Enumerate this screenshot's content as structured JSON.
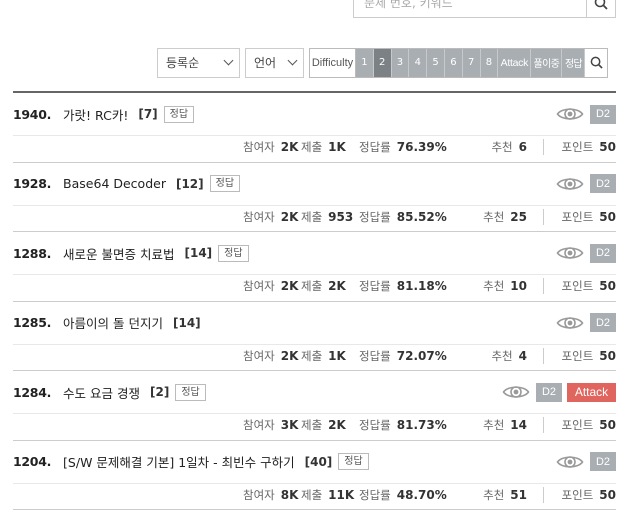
{
  "search": {
    "placeholder": "문제 번호, 키워드"
  },
  "filters": {
    "order_label": "등록순",
    "lang_label": "언어",
    "difficulty_label": "Difficulty",
    "difficulty_levels": [
      "1",
      "2",
      "3",
      "4",
      "5",
      "6",
      "7",
      "8"
    ],
    "active_level": "2",
    "extra_labels": [
      "Attack",
      "풀이중",
      "정답"
    ]
  },
  "labels": {
    "answer_tag": "정답",
    "participants": "참여자",
    "submissions": "제출",
    "accuracy": "정답률",
    "recommend": "추천",
    "points": "포인트"
  },
  "problems": [
    {
      "number": "1940.",
      "title": "가랏! RC카!",
      "count": "[7]",
      "has_answer": true,
      "difficulty": "D2",
      "attack": false,
      "participants": "2K",
      "submissions": "1K",
      "accuracy": "76.39%",
      "recommend": "6",
      "points": "50"
    },
    {
      "number": "1928.",
      "title": "Base64 Decoder",
      "count": "[12]",
      "has_answer": true,
      "difficulty": "D2",
      "attack": false,
      "participants": "2K",
      "submissions": "953",
      "accuracy": "85.52%",
      "recommend": "25",
      "points": "50"
    },
    {
      "number": "1288.",
      "title": "새로운 불면증 치료법",
      "count": "[14]",
      "has_answer": true,
      "difficulty": "D2",
      "attack": false,
      "participants": "2K",
      "submissions": "2K",
      "accuracy": "81.18%",
      "recommend": "10",
      "points": "50"
    },
    {
      "number": "1285.",
      "title": "아름이의 돌 던지기",
      "count": "[14]",
      "has_answer": false,
      "difficulty": "D2",
      "attack": false,
      "participants": "2K",
      "submissions": "1K",
      "accuracy": "72.07%",
      "recommend": "4",
      "points": "50"
    },
    {
      "number": "1284.",
      "title": "수도 요금 경쟁",
      "count": "[2]",
      "has_answer": true,
      "difficulty": "D2",
      "attack": true,
      "attack_label": "Attack",
      "participants": "3K",
      "submissions": "2K",
      "accuracy": "81.73%",
      "recommend": "14",
      "points": "50"
    },
    {
      "number": "1204.",
      "title": "[S/W 문제해결 기본] 1일차 - 최빈수 구하기",
      "count": "[40]",
      "has_answer": true,
      "difficulty": "D2",
      "attack": false,
      "participants": "8K",
      "submissions": "11K",
      "accuracy": "48.70%",
      "recommend": "51",
      "points": "50"
    }
  ],
  "colors": {
    "badge_gray": "#a9aeb3",
    "attack_red": "#e0655f",
    "active_level": "#7c8186"
  }
}
